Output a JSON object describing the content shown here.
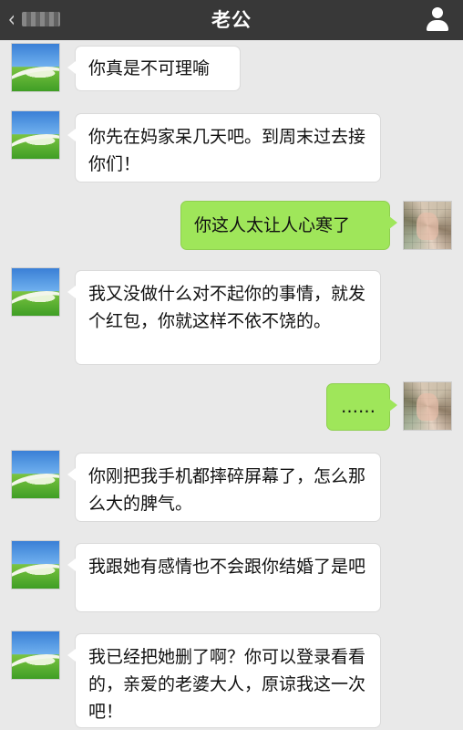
{
  "header": {
    "title": "老公"
  },
  "icons": {
    "back": "chevron-left-icon",
    "profile": "person-icon"
  },
  "colors": {
    "topbar": "#383838",
    "background": "#e9e9e9",
    "sent_bubble": "#9fe65a",
    "received_bubble": "#ffffff"
  },
  "messages": [
    {
      "side": "left",
      "text": "你真是不可理喻"
    },
    {
      "side": "left",
      "text": "你先在妈家呆几天吧。到周末过去接你们！"
    },
    {
      "side": "right",
      "text": "你这人太让人心寒了"
    },
    {
      "side": "left",
      "text": "我又没做什么对不起你的事情，就发个红包，你就这样不依不饶的。"
    },
    {
      "side": "right",
      "text": "……"
    },
    {
      "side": "left",
      "text": "你刚把我手机都摔碎屏幕了，怎么那么大的脾气。"
    },
    {
      "side": "left",
      "text": "我跟她有感情也不会跟你结婚了是吧"
    },
    {
      "side": "left",
      "text": "我已经把她删了啊？你可以登录看看的，亲爱的老婆大人，原谅我这一次吧！"
    }
  ]
}
